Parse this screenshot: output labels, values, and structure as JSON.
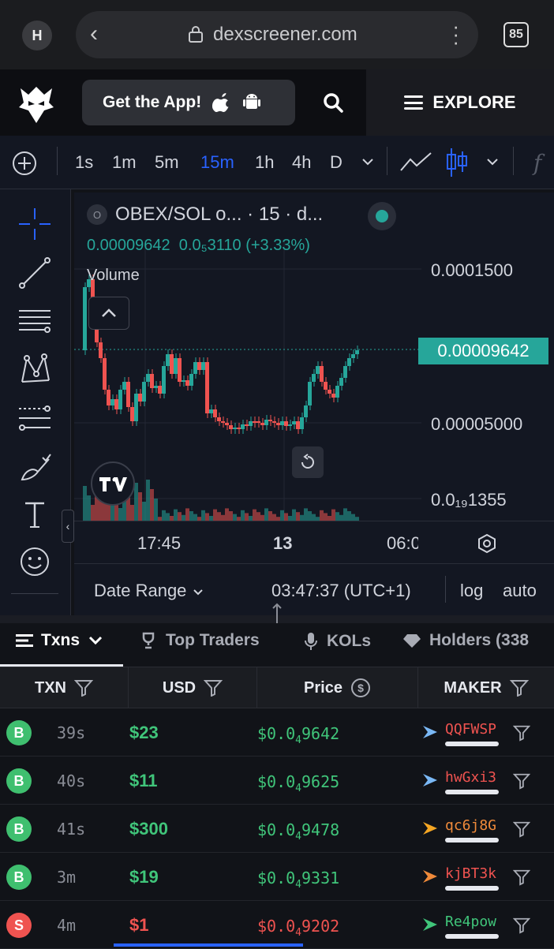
{
  "browser": {
    "profile_initial": "H",
    "url": "dexscreener.com",
    "tab_count": "85"
  },
  "appbar": {
    "get_app_label": "Get the App!",
    "explore_label": "EXPLORE"
  },
  "timeframes": {
    "items": [
      "1s",
      "1m",
      "5m",
      "15m",
      "1h",
      "4h",
      "D"
    ],
    "active": "15m"
  },
  "chart": {
    "legend_title": "OBEX/SOL o... · 15 · d...",
    "last_price": "0.00009642",
    "change": "0.0₅3110 (+3.33%)",
    "volume_label": "Volume",
    "y_labels": [
      "0.0001500",
      "0.00005000",
      "0.0₁₉1355"
    ],
    "y_badge": "0.00009642",
    "x_labels": [
      "17:45",
      "13",
      "06:0"
    ],
    "date_range": "Date Range",
    "clock": "03:47:37 (UTC+1)",
    "log": "log",
    "auto": "auto",
    "colors": {
      "up": "#26a69a",
      "down": "#ef5350",
      "accent": "#2962ff"
    }
  },
  "chart_data": {
    "type": "candlestick",
    "x": [
      "17:45",
      "13",
      "06:0"
    ],
    "ylim": [
      1.35e-05,
      0.00015
    ],
    "last": 9.642e-05
  },
  "tabs": [
    {
      "label": "Txns",
      "icon": "list-icon",
      "active": true
    },
    {
      "label": "Top Traders",
      "icon": "trophy-icon"
    },
    {
      "label": "KOLs",
      "icon": "microphone-icon"
    },
    {
      "label": "Holders (338",
      "icon": "diamond-icon"
    }
  ],
  "columns": [
    "TXN",
    "USD",
    "Price",
    "MAKER"
  ],
  "rows": [
    {
      "type": "B",
      "age": "39s",
      "usd": "$23",
      "price_prefix": "$0.0",
      "price_sub": "4",
      "price_digits": "9642",
      "maker": "QQFWSP",
      "maker_color": "#ef5350",
      "icon": "arrow-icon"
    },
    {
      "type": "B",
      "age": "40s",
      "usd": "$11",
      "price_prefix": "$0.0",
      "price_sub": "4",
      "price_digits": "9625",
      "maker": "hwGxi3",
      "maker_color": "#ef5350",
      "icon": "arrow-icon"
    },
    {
      "type": "B",
      "age": "41s",
      "usd": "$300",
      "price_prefix": "$0.0",
      "price_sub": "4",
      "price_digits": "9478",
      "maker": "qc6j8G",
      "maker_color": "#f08a3a",
      "icon": "sparkle-icon"
    },
    {
      "type": "B",
      "age": "3m",
      "usd": "$19",
      "price_prefix": "$0.0",
      "price_sub": "4",
      "price_digits": "9331",
      "maker": "kjBT3k",
      "maker_color": "#ef5350",
      "icon": "bird-icon"
    },
    {
      "type": "S",
      "age": "4m",
      "usd": "$1",
      "price_prefix": "$0.0",
      "price_sub": "4",
      "price_digits": "9202",
      "maker": "Re4pow",
      "maker_color": "#40c57a",
      "icon": "frog-icon"
    }
  ]
}
